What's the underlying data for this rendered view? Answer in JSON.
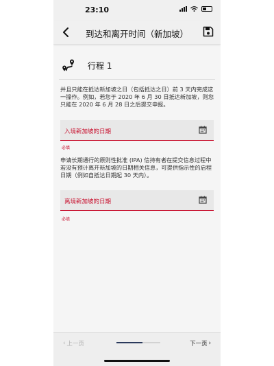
{
  "status_bar": {
    "time": "23:10"
  },
  "nav": {
    "title": "到达和离开时间（新加坡）",
    "back_icon": "chevron-left-icon",
    "save_icon": "floppy-disk-icon"
  },
  "trip": {
    "icon": "route-icon",
    "label": "行程 1"
  },
  "intro_text": "并且只能在抵达新加坡之日（包括抵达之日）前 3 天内完成这一操作。例如，若您于 2020 年 6 月 30 日抵达新加坡，则您只能在 2020 年 6 月 28 日之后提交申报。",
  "arrival_field": {
    "label": "入境新加坡的日期",
    "icon": "calendar-icon",
    "required_text": "必填"
  },
  "ipa_text": "申请长期通行的原则性批准 (IPA) 信持有者在提交信息过程中若没有预计离开新加坡的日期相关信息，可提供指示性的启程日期（例如自抵达日期起 30 天内）。",
  "departure_field": {
    "label": "离境新加坡的日期",
    "icon": "calendar-icon",
    "required_text": "必填"
  },
  "footer": {
    "prev_label": "上一页",
    "next_label": "下一页",
    "progress_fraction": 0.6
  },
  "colors": {
    "accent_red": "#c8102e",
    "progress_navy": "#2b3a5c"
  }
}
